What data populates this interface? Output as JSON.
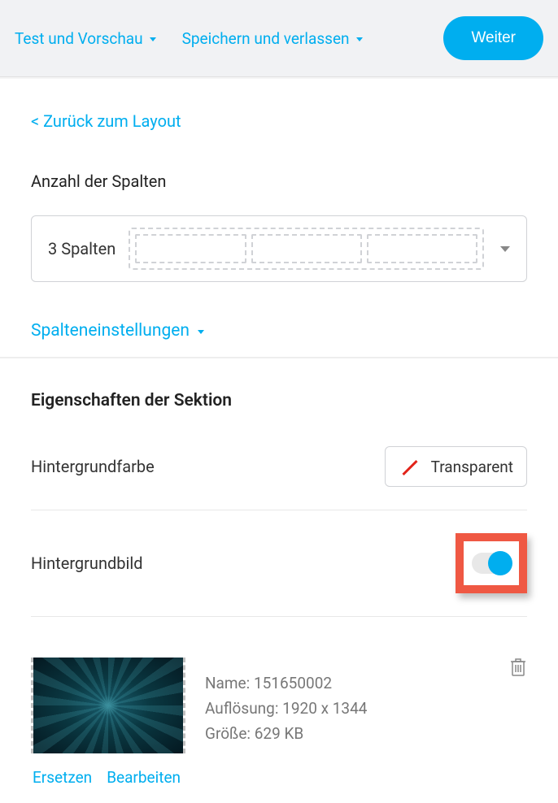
{
  "header": {
    "test_preview": "Test und Vorschau",
    "save_exit": "Speichern und verlassen",
    "continue": "Weiter"
  },
  "back_link": "< Zurück zum Layout",
  "columns": {
    "label": "Anzahl der Spalten",
    "selected": "3 Spalten"
  },
  "column_settings": "Spalteneinstellungen",
  "section": {
    "title": "Eigenschaften der Sektion",
    "bg_color_label": "Hintergrundfarbe",
    "bg_color_value": "Transparent",
    "bg_image_label": "Hintergrundbild"
  },
  "image": {
    "name_label": "Name:",
    "name_value": "151650002",
    "resolution_label": "Auflösung:",
    "resolution_value": "1920 x 1344",
    "size_label": "Größe:",
    "size_value": "629 KB",
    "replace": "Ersetzen",
    "edit": "Bearbeiten"
  }
}
